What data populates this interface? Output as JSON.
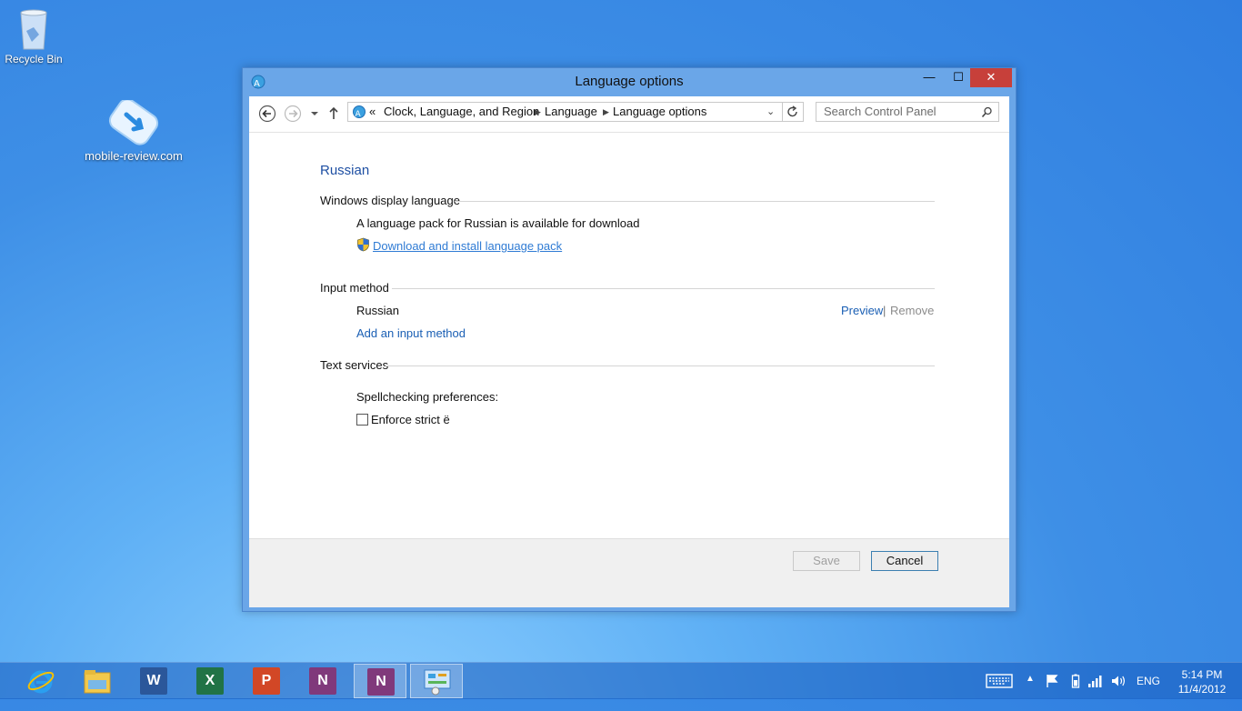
{
  "desktop": {
    "recycle_bin_label": "Recycle Bin",
    "watermark_label": "mobile-review.com"
  },
  "window": {
    "title": "Language options",
    "minimize_label": "—",
    "maximize_label": "☐",
    "close_label": "✕"
  },
  "nav": {
    "address_prefix": "«",
    "breadcrumbs": [
      "Clock, Language, and Region",
      "Language",
      "Language options"
    ],
    "search_placeholder": "Search Control Panel"
  },
  "content": {
    "heading": "Russian",
    "display_language": {
      "title": "Windows display language",
      "message": "A language pack for Russian is available for download",
      "download_link": "Download and install language pack"
    },
    "input_method": {
      "title": "Input method",
      "item": "Russian",
      "preview_link": "Preview",
      "separator": "|",
      "remove_link": "Remove",
      "add_link": "Add an input method"
    },
    "text_services": {
      "title": "Text services",
      "spellcheck_label": "Spellchecking preferences:",
      "enforce_label": "Enforce strict ё",
      "enforce_checked": false
    }
  },
  "footer": {
    "save_label": "Save",
    "cancel_label": "Cancel"
  },
  "taskbar": {
    "apps": [
      {
        "name": "internet-explorer",
        "active": false
      },
      {
        "name": "file-explorer",
        "active": false
      },
      {
        "name": "word",
        "glyph": "W",
        "color": "#2b579a",
        "active": false
      },
      {
        "name": "excel",
        "glyph": "X",
        "color": "#217346",
        "active": false
      },
      {
        "name": "powerpoint",
        "glyph": "P",
        "color": "#d24726",
        "active": false
      },
      {
        "name": "onenote",
        "glyph": "N",
        "color": "#80397b",
        "active": false
      },
      {
        "name": "onenote-clipper",
        "glyph": "N",
        "color": "#80397b",
        "active": true
      },
      {
        "name": "control-panel",
        "active": true
      }
    ],
    "language": "ENG",
    "time": "5:14 PM",
    "date": "11/4/2012"
  },
  "colors": {
    "accent_link": "#1a5fb4",
    "close_button": "#c7403a"
  }
}
